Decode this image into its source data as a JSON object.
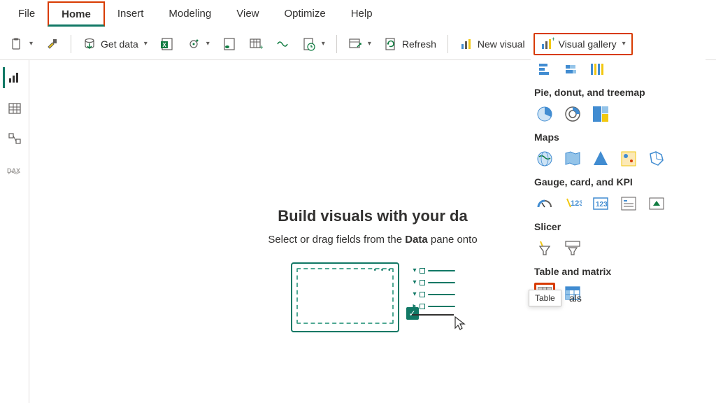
{
  "menubar": {
    "items": [
      {
        "label": "File"
      },
      {
        "label": "Home",
        "active": true,
        "highlighted": true
      },
      {
        "label": "Insert"
      },
      {
        "label": "Modeling"
      },
      {
        "label": "View"
      },
      {
        "label": "Optimize"
      },
      {
        "label": "Help"
      }
    ]
  },
  "toolbar": {
    "get_data": "Get data",
    "refresh": "Refresh",
    "new_visual": "New visual",
    "visual_gallery": "Visual gallery"
  },
  "canvas": {
    "title": "Build visuals with your da",
    "sub_before": "Select or drag fields from the ",
    "sub_bold": "Data",
    "sub_after": " pane onto "
  },
  "gallery": {
    "sections": {
      "pie": "Pie, donut, and treemap",
      "maps": "Maps",
      "gauge": "Gauge, card, and KPI",
      "slicer": "Slicer",
      "table": "Table and matrix"
    },
    "tooltip": "Table",
    "truncated_label": "als"
  }
}
